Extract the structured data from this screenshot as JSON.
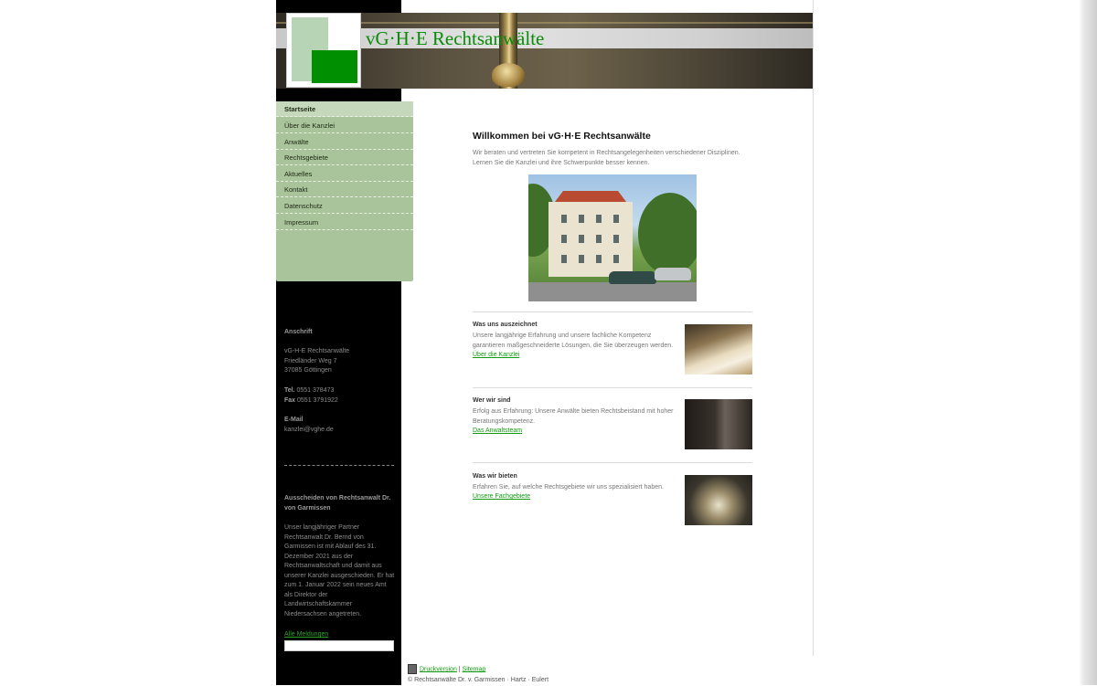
{
  "header": {
    "site_title": "vG·H·E Rechtsanwälte"
  },
  "nav": {
    "items": [
      {
        "label": "Startseite",
        "active": true
      },
      {
        "label": "Über die Kanzlei"
      },
      {
        "label": "Anwälte"
      },
      {
        "label": "Rechtsgebiete"
      },
      {
        "label": "Aktuelles"
      },
      {
        "label": "Kontakt"
      },
      {
        "label": "Datenschutz"
      },
      {
        "label": "Impressum"
      }
    ]
  },
  "sidebar": {
    "address_heading": "Anschrift",
    "address_lines": [
      "vG-H-E Rechtsanwälte",
      "Friedländer Weg 7",
      "37085 Göttingen"
    ],
    "tel_label": "Tel.",
    "tel_value": "0551 378473",
    "fax_label": "Fax",
    "fax_value": "0551 3791922",
    "email_heading": "E-Mail",
    "email_value": "kanzlei@vghe.de",
    "news_heading": "Ausscheiden von Rechtsanwalt Dr. von Garmissen",
    "news_text": "Unser langjähriger Partner Rechtsanwalt Dr. Bernd von Garmissen ist mit Ablauf des 31. Dezember 2021 aus der Rechtsanwaltschaft und damit aus unserer Kanzlei ausgeschieden. Er hat zum 1. Januar 2022 sein neues Amt als Direktor der Landwirtschaftskammer Niedersachsen angetreten.",
    "all_news_link": "Alle Meldungen"
  },
  "main": {
    "title": "Willkommen bei vG·H·E Rechtsanwälte",
    "intro": "Wir beraten und vertreten Sie kompetent in Rechtsangelegenheiten verschiedener Disziplinen. Lernen Sie die Kanzlei und ihre Schwerpunkte besser kennen.",
    "sections": [
      {
        "title": "Was uns auszeichnet",
        "text": "Unsere langjährige Erfahrung und unsere fachliche Kompetenz garantieren maßgeschneiderte Lösungen, die Sie überzeugen werden.",
        "link": "Über die Kanzlei"
      },
      {
        "title": "Wer wir sind",
        "text": "Erfolg aus Erfahrung: Unsere Anwälte bieten Rechtsbeistand mit hoher Beratungskompetenz.",
        "link": "Das Anwaltsteam"
      },
      {
        "title": "Was wir bieten",
        "text": "Erfahren Sie, auf welche Rechtsgebiete wir uns spezialisiert haben.",
        "link": "Unsere Fachgebiete"
      }
    ]
  },
  "footer": {
    "print_link": "Druckversion",
    "sitemap_link": "Sitemap",
    "copyright": "© Rechtsanwälte Dr. v. Garmissen · Hartz · Eulert"
  },
  "colors": {
    "accent_green": "#129a12",
    "nav_bg": "#a9c39a",
    "logo_dark": "#008f00",
    "logo_light": "#b7d4b4"
  }
}
